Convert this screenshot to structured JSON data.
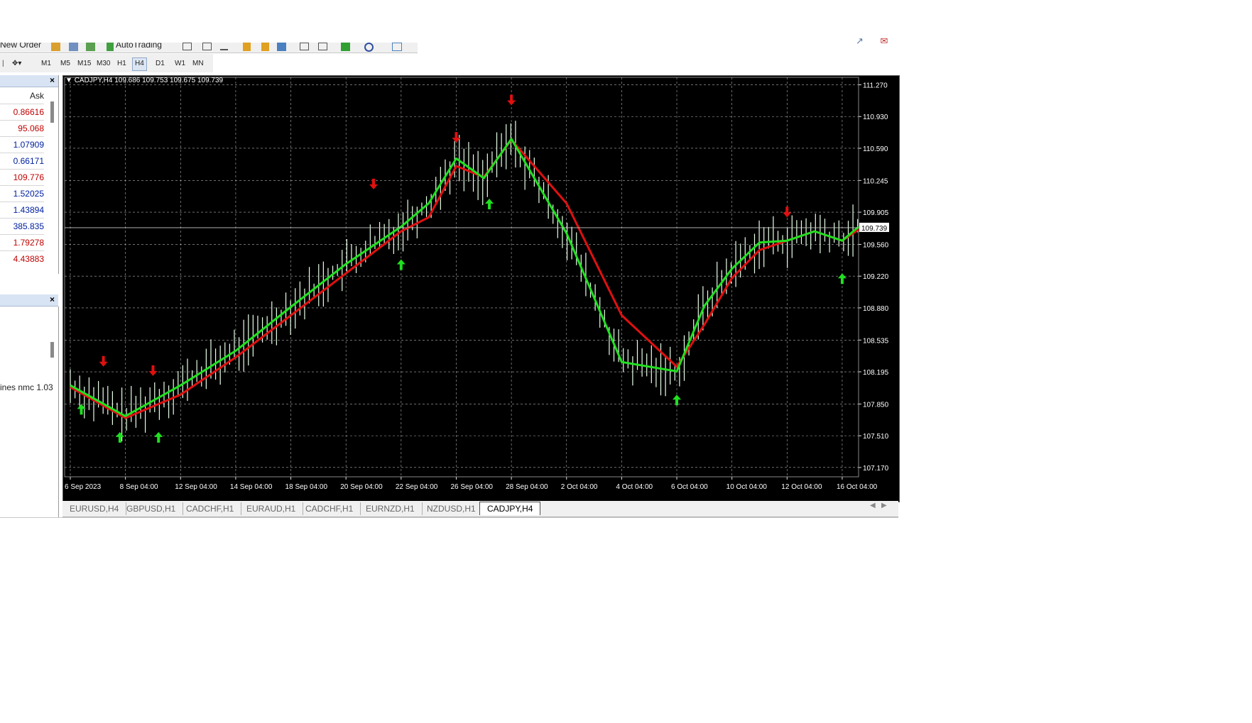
{
  "toolbar": {
    "new_order": "New Order",
    "auto_trading": "AutoTrading",
    "icons": [
      "order-icon",
      "open-icon",
      "profiles-icon",
      "autotrading-icon",
      "crosshair-icon",
      "period-icon",
      "line-icon",
      "zoom-in-icon",
      "zoom-out-icon",
      "tile-icon",
      "scroll-icon",
      "shift-icon",
      "indicators-icon",
      "refresh-icon",
      "templates-icon"
    ]
  },
  "timeframes": [
    "M1",
    "M5",
    "M15",
    "M30",
    "H1",
    "H4",
    "D1",
    "W1",
    "MN"
  ],
  "active_timeframe": "H4",
  "market_watch": {
    "ask_header": "Ask",
    "quotes": [
      {
        "value": "0.86616",
        "color": "red"
      },
      {
        "value": "95.068",
        "color": "red"
      },
      {
        "value": "1.07909",
        "color": "blue"
      },
      {
        "value": "0.66171",
        "color": "blue"
      },
      {
        "value": "109.776",
        "color": "red"
      },
      {
        "value": "1.52025",
        "color": "blue"
      },
      {
        "value": "1.43894",
        "color": "blue"
      },
      {
        "value": "385.835",
        "color": "blue"
      },
      {
        "value": "1.79278",
        "color": "red"
      },
      {
        "value": "4.43883",
        "color": "red"
      }
    ]
  },
  "navigator": {
    "item": "ines nmc 1.03"
  },
  "chart": {
    "title": "CADJPY,H4  109.686 109.753 109.675 109.739",
    "current_price": "109.739",
    "price_labels": [
      "111.270",
      "110.930",
      "110.590",
      "110.245",
      "109.905",
      "109.560",
      "109.220",
      "108.880",
      "108.535",
      "108.195",
      "107.850",
      "107.510",
      "107.170"
    ],
    "time_labels": [
      "6 Sep 2023",
      "8 Sep 04:00",
      "12 Sep 04:00",
      "14 Sep 04:00",
      "18 Sep 04:00",
      "20 Sep 04:00",
      "22 Sep 04:00",
      "26 Sep 04:00",
      "28 Sep 04:00",
      "2 Oct 04:00",
      "4 Oct 04:00",
      "6 Oct 04:00",
      "10 Oct 04:00",
      "12 Oct 04:00",
      "16 Oct 04:00"
    ],
    "colors": {
      "background": "#000000",
      "grid": "#b0b0b0",
      "fast_line": "#20e020",
      "slow_line": "#e01010",
      "up_arrow": "#20e020",
      "down_arrow": "#e01010",
      "candles": "#e8ffe8"
    }
  },
  "chart_data": {
    "type": "line",
    "title": "CADJPY,H4",
    "x": [
      "6 Sep 2023",
      "8 Sep 04:00",
      "12 Sep 04:00",
      "14 Sep 04:00",
      "18 Sep 04:00",
      "20 Sep 04:00",
      "22 Sep 04:00",
      "26 Sep 04:00",
      "28 Sep 04:00",
      "2 Oct 04:00",
      "4 Oct 04:00",
      "6 Oct 04:00",
      "10 Oct 04:00",
      "12 Oct 04:00",
      "16 Oct 04:00"
    ],
    "ylim": [
      107.07,
      111.35
    ],
    "grid": true,
    "current_price": 109.739,
    "series": [
      {
        "values": [
          108.05,
          107.72,
          108.05,
          108.42,
          108.89,
          109.35,
          109.75,
          110.0,
          110.48,
          110.27,
          110.69,
          109.68,
          108.3,
          108.2,
          108.9,
          109.3,
          109.58,
          109.6,
          109.7,
          109.6,
          109.75
        ]
      },
      {
        "values": [
          108.03,
          107.7,
          107.95,
          108.35,
          108.8,
          109.25,
          109.7,
          109.85,
          110.4,
          110.28,
          110.68,
          110.0,
          108.8,
          108.25,
          108.7,
          109.2,
          109.5,
          109.6,
          109.7,
          109.6,
          109.72
        ]
      }
    ],
    "series_x_index": [
      0,
      1,
      2,
      3,
      4,
      5,
      6,
      6.5,
      7,
      7.5,
      8,
      9,
      10,
      11,
      11.5,
      12,
      12.5,
      13,
      13.5,
      14,
      14.3
    ],
    "up_signals": [
      [
        0.2,
        107.85
      ],
      [
        0.9,
        107.55
      ],
      [
        1.6,
        107.55
      ],
      [
        6.0,
        109.4
      ],
      [
        7.6,
        110.05
      ],
      [
        11.0,
        107.95
      ],
      [
        14.0,
        109.25
      ]
    ],
    "down_signals": [
      [
        0.6,
        108.25
      ],
      [
        1.5,
        108.15
      ],
      [
        5.5,
        110.15
      ],
      [
        7.0,
        110.65
      ],
      [
        8.0,
        111.05
      ],
      [
        13.0,
        109.85
      ]
    ]
  },
  "tabs": [
    "EURUSD,H4",
    "GBPUSD,H1",
    "CADCHF,H1",
    "EURAUD,H1",
    "CADCHF,H1",
    "EURNZD,H1",
    "NZDUSD,H1",
    "CADJPY,H4"
  ],
  "active_tab": "CADJPY,H4"
}
